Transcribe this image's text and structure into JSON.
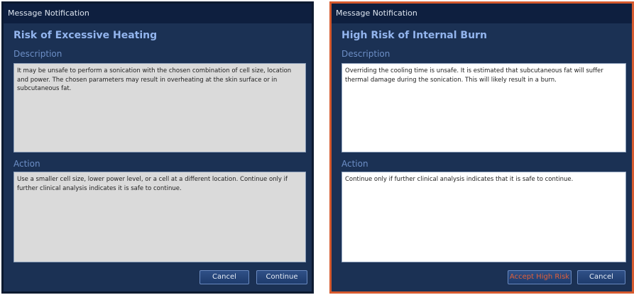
{
  "left_dialog": {
    "window_title": "Message Notification",
    "heading": "Risk of Excessive Heating",
    "description_label": "Description",
    "description_text": "It may be unsafe to perform a sonication with the chosen combination of cell size, location and power. The chosen parameters may result in overheating at the skin surface or in subcutaneous fat.",
    "action_label": "Action",
    "action_text": "Use a smaller cell size, lower power level, or a cell at a different location. Continue only if further clinical analysis indicates it is safe to continue.",
    "cancel_label": "Cancel",
    "continue_label": "Continue"
  },
  "right_dialog": {
    "window_title": "Message Notification",
    "heading": "High Risk of Internal Burn",
    "description_label": "Description",
    "description_text": "Overriding the cooling time is unsafe. It is estimated that subcutaneous fat will suffer thermal damage during the sonication. This will likely result in a burn.",
    "action_label": "Action",
    "action_text": "Continue only if further clinical analysis indicates that it is safe to continue.",
    "accept_label": "Accept High Risk",
    "cancel_label": "Cancel"
  },
  "colors": {
    "dialog_background": "#1b3154",
    "titlebar": "#0e1f3f",
    "heading_text": "#93b5ee",
    "section_label": "#6d8fc7",
    "warning_border": "#d65a2e",
    "warning_button_text": "#e0603a"
  }
}
